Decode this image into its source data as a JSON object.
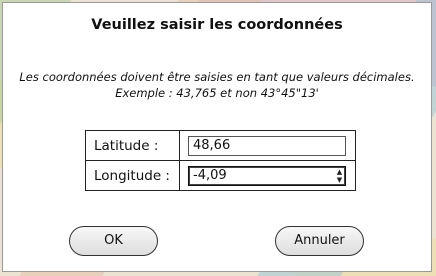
{
  "dialog": {
    "title": "Veuillez saisir les coordonnées",
    "message_line1": "Les coordonnées doivent être saisies en tant que valeurs décimales.",
    "message_line2": "Exemple : 43,765 et non 43°45\"13'"
  },
  "fields": {
    "latitude_label": "Latitude :",
    "latitude_value": "48,66",
    "longitude_label": "Longitude :",
    "longitude_value": "-4,09"
  },
  "buttons": {
    "ok_label": "OK",
    "cancel_label": "Annuler"
  },
  "icons": {
    "spinner": "spinner-arrows-icon"
  }
}
